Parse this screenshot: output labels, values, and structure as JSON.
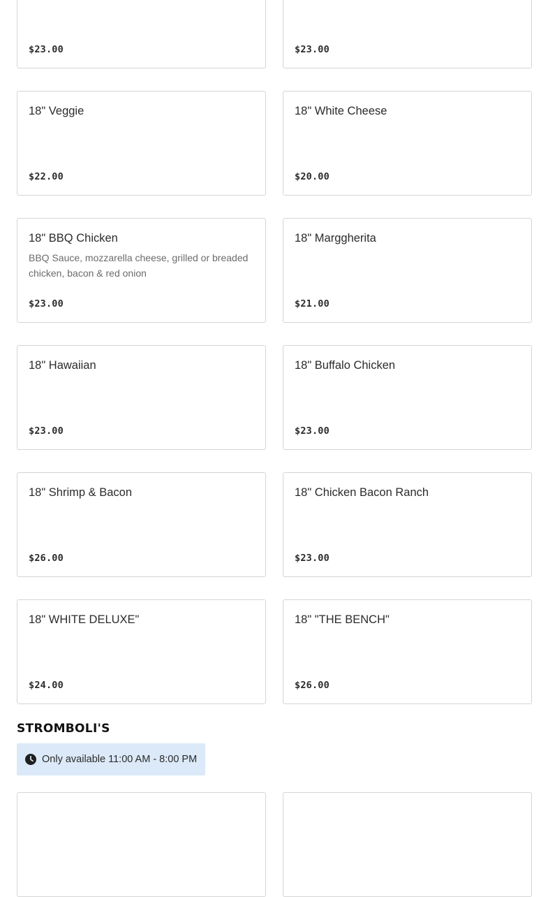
{
  "menu_items": [
    {
      "name": "",
      "description": "",
      "price": "$23.00"
    },
    {
      "name": "",
      "description": "",
      "price": "$23.00"
    },
    {
      "name": "18\" Veggie",
      "description": "",
      "price": "$22.00"
    },
    {
      "name": "18\" White Cheese",
      "description": "",
      "price": "$20.00"
    },
    {
      "name": "18\" BBQ Chicken",
      "description": "BBQ Sauce, mozzarella cheese, grilled or breaded chicken, bacon & red onion",
      "price": "$23.00"
    },
    {
      "name": "18\" Marggherita",
      "description": "",
      "price": "$21.00"
    },
    {
      "name": "18\" Hawaiian",
      "description": "",
      "price": "$23.00"
    },
    {
      "name": "18\" Buffalo Chicken",
      "description": "",
      "price": "$23.00"
    },
    {
      "name": "18\" Shrimp & Bacon",
      "description": "",
      "price": "$26.00"
    },
    {
      "name": "18\" Chicken Bacon Ranch",
      "description": "",
      "price": "$23.00"
    },
    {
      "name": "18\" WHITE DELUXE\"",
      "description": "",
      "price": "$24.00"
    },
    {
      "name": "18\" \"THE BENCH\"",
      "description": "",
      "price": "$26.00"
    },
    {
      "name": "",
      "description": "",
      "price": ""
    },
    {
      "name": "",
      "description": "",
      "price": ""
    }
  ],
  "section": {
    "title": "STROMBOLI'S",
    "availability": "Only available 11:00 AM - 8:00 PM",
    "icon": "clock-icon"
  }
}
